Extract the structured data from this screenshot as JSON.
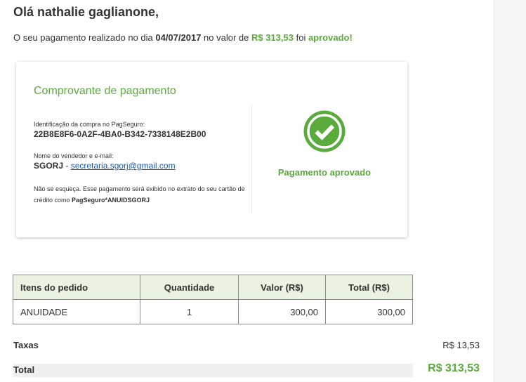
{
  "greeting": "Olá nathalie gaglianone,",
  "message": {
    "prefix": "O seu pagamento realizado no dia ",
    "date": "04/07/2017",
    "middle": " no valor de ",
    "amount": "R$ 313,53",
    "connector": " foi ",
    "status": "aprovado!"
  },
  "receipt": {
    "title": "Comprovante de pagamento",
    "id_label": "Identificação da compra no PagSeguro:",
    "id_value": "22B8E8F6-0A2F-4BA0-B342-7338148E2B00",
    "seller_label": "Nome do vendedor e e-mail:",
    "seller_name": "SGORJ",
    "seller_separator": " - ",
    "seller_email": "secretaria.sgorj@gmail.com",
    "note_text": "Não se esqueça. Esse pagamento será exibido no extrato do seu cartão de crédito como ",
    "note_descriptor": "PagSeguro*ANUIDSGORJ",
    "status_label": "Pagamento aprovado",
    "status_icon": "check-circle-icon"
  },
  "order_table": {
    "headers": [
      "Itens do pedido",
      "Quantidade",
      "Valor (R$)",
      "Total (R$)"
    ],
    "rows": [
      {
        "item": "ANUIDADE",
        "quantity": "1",
        "value": "300,00",
        "total": "300,00"
      }
    ]
  },
  "summary": {
    "taxes_label": "Taxas",
    "taxes_value": "R$ 13,53",
    "total_label": "Total",
    "total_value": "R$ 313,53"
  },
  "colors": {
    "accent_green": "#5aaa3c",
    "link_blue": "#1a57b5",
    "table_header_bg": "#eaf3e1"
  }
}
